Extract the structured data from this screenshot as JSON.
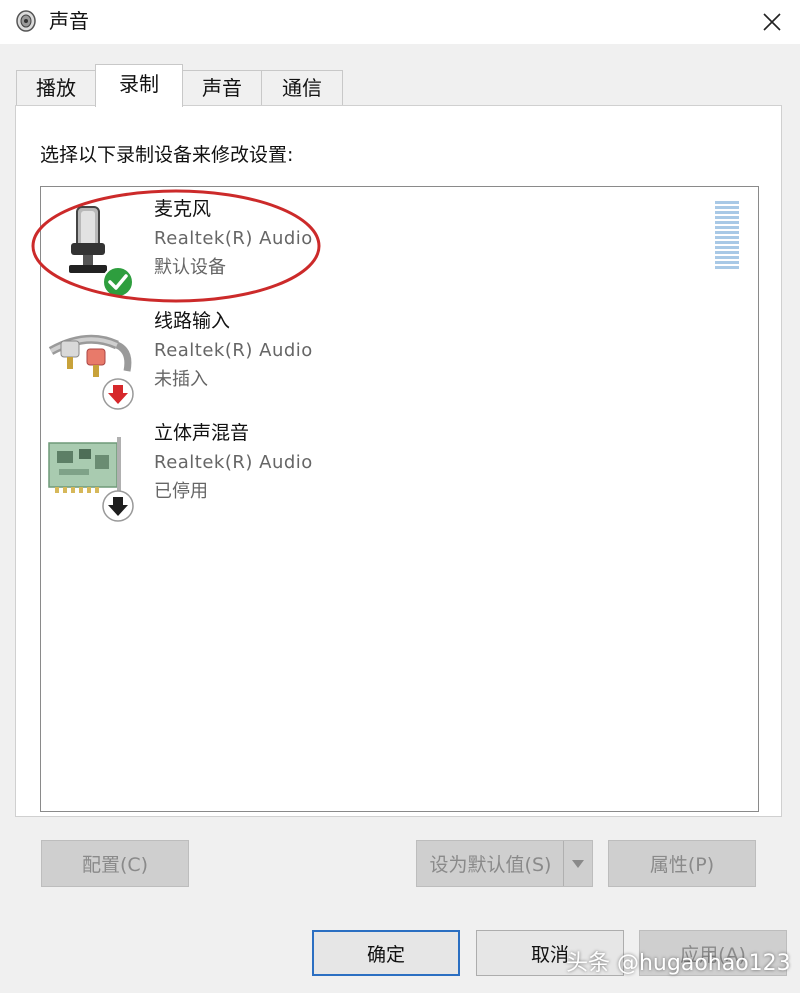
{
  "window": {
    "title": "声音"
  },
  "tabs": [
    {
      "label": "播放",
      "active": false
    },
    {
      "label": "录制",
      "active": true
    },
    {
      "label": "声音",
      "active": false
    },
    {
      "label": "通信",
      "active": false
    }
  ],
  "panel": {
    "instruction": "选择以下录制设备来修改设置:"
  },
  "devices": [
    {
      "name": "麦克风",
      "driver": "Realtek(R) Audio",
      "status": "默认设备",
      "icon": "microphone-icon",
      "badge": "default-check-icon",
      "selected_highlight": true
    },
    {
      "name": "线路输入",
      "driver": "Realtek(R) Audio",
      "status": "未插入",
      "icon": "line-in-cable-icon",
      "badge": "unplugged-down-arrow-icon"
    },
    {
      "name": "立体声混音",
      "driver": "Realtek(R) Audio",
      "status": "已停用",
      "icon": "sound-card-icon",
      "badge": "disabled-down-arrow-icon"
    }
  ],
  "buttons": {
    "configure": "配置(C)",
    "set_default": "设为默认值(S)",
    "properties": "属性(P)",
    "ok": "确定",
    "cancel": "取消",
    "apply": "应用(A)"
  },
  "watermark": "头条 @hugaohao123",
  "colors": {
    "accent_border": "#2b6fc2",
    "highlight_circle": "#cc2a2a",
    "default_badge": "#2e9e3e",
    "unplugged_badge": "#d6282b"
  }
}
